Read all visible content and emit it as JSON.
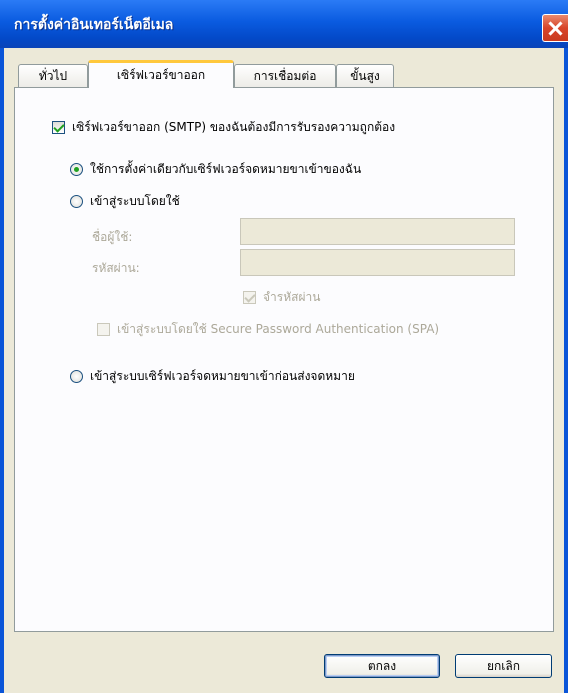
{
  "window": {
    "title": "การตั้งค่าอินเทอร์เน็ตอีเมล"
  },
  "tabs": [
    {
      "label": "ทั่วไป"
    },
    {
      "label": "เซิร์ฟเวอร์ขาออก"
    },
    {
      "label": "การเชื่อมต่อ"
    },
    {
      "label": "ขั้นสูง"
    }
  ],
  "outgoing": {
    "smtp_auth_label": "เซิร์ฟเวอร์ขาออก (SMTP) ของฉันต้องมีการรับรองความถูกต้อง",
    "smtp_auth_checked": true,
    "option_same_settings_label": "ใช้การตั้งค่าเดียวกับเซิร์ฟเวอร์จดหมายขาเข้าของฉัน",
    "option_login_using_label": "เข้าสู่ระบบโดยใช้",
    "username_label": "ชื่อผู้ใช้:",
    "username_value": "",
    "password_label": "รหัสผ่าน:",
    "password_value": "",
    "remember_password_label": "จำรหัสผ่าน",
    "spa_label": "เข้าสู่ระบบโดยใช้ Secure Password Authentication (SPA)",
    "option_login_incoming_first_label": "เข้าสู่ระบบเซิร์ฟเวอร์จดหมายขาเข้าก่อนส่งจดหมาย"
  },
  "buttons": {
    "ok_label": "ตกลง",
    "cancel_label": "ยกเลิก"
  }
}
